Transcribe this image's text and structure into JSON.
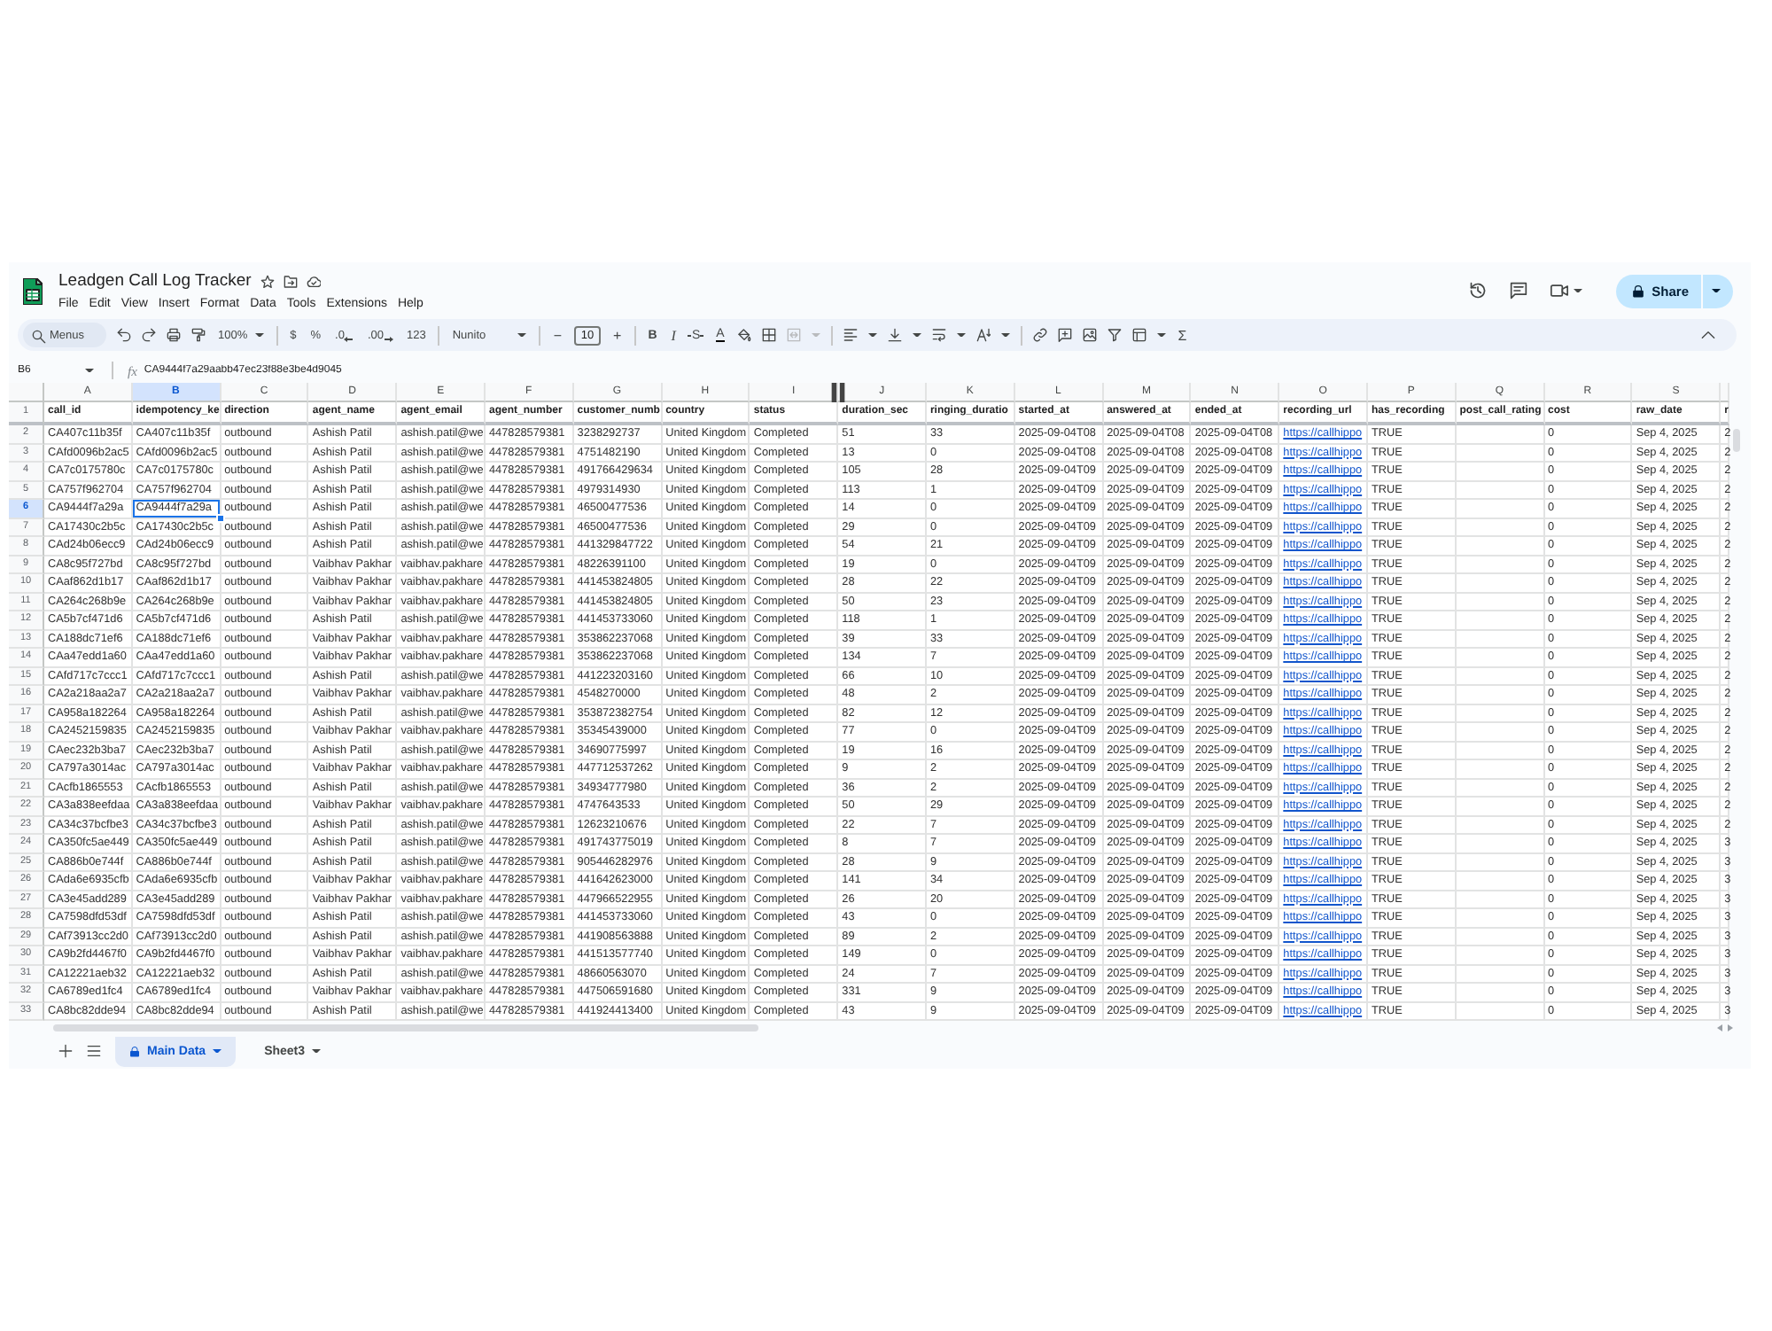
{
  "app": {
    "title": "Leadgen Call Log Tracker",
    "menu": [
      "File",
      "Edit",
      "View",
      "Insert",
      "Format",
      "Data",
      "Tools",
      "Extensions",
      "Help"
    ],
    "share_label": "Share"
  },
  "toolbar": {
    "search": {
      "placeholder": "Menus"
    },
    "zoom": "100%",
    "currency": "$",
    "percent": "%",
    "decrease_decimals": ".0",
    "increase_decimals": ".00",
    "number_format": "123",
    "font": "Nunito",
    "decrease_font": "−",
    "font_size": "10",
    "increase_font": "+",
    "bold": "B",
    "italic": "I",
    "strikethrough": "S",
    "text_color": "A",
    "merge_cells": {
      "disabled": true
    },
    "functions": "Σ"
  },
  "formula_bar": {
    "cell_ref": "B6",
    "fx": "fx",
    "value": "CA9444f7a29aabb47ec23f88e3be4d9045"
  },
  "sheet": {
    "columns": [
      {
        "letter": "A",
        "selected": false,
        "header": "call_id",
        "kind": "text"
      },
      {
        "letter": "B",
        "selected": true,
        "header": "idempotency_ke",
        "kind": "text"
      },
      {
        "letter": "C",
        "selected": false,
        "header": "direction",
        "kind": "text"
      },
      {
        "letter": "D",
        "selected": false,
        "header": "agent_name",
        "kind": "text"
      },
      {
        "letter": "E",
        "selected": false,
        "header": "agent_email",
        "kind": "text"
      },
      {
        "letter": "F",
        "selected": false,
        "header": "agent_number",
        "kind": "text"
      },
      {
        "letter": "G",
        "selected": false,
        "header": "customer_numb",
        "kind": "text"
      },
      {
        "letter": "H",
        "selected": false,
        "header": "country",
        "kind": "text"
      },
      {
        "letter": "I",
        "selected": false,
        "header": "status",
        "kind": "text"
      },
      {
        "letter": "J",
        "selected": false,
        "header": "duration_sec",
        "kind": "text"
      },
      {
        "letter": "K",
        "selected": false,
        "header": "ringing_duratio",
        "kind": "text"
      },
      {
        "letter": "L",
        "selected": false,
        "header": "started_at",
        "kind": "text"
      },
      {
        "letter": "M",
        "selected": false,
        "header": "answered_at",
        "kind": "text"
      },
      {
        "letter": "N",
        "selected": false,
        "header": "ended_at",
        "kind": "text"
      },
      {
        "letter": "O",
        "selected": false,
        "header": "recording_url",
        "kind": "link"
      },
      {
        "letter": "P",
        "selected": false,
        "header": "has_recording",
        "kind": "text"
      },
      {
        "letter": "Q",
        "selected": false,
        "header": "post_call_rating",
        "kind": "text"
      },
      {
        "letter": "R",
        "selected": false,
        "header": "cost",
        "kind": "text"
      },
      {
        "letter": "S",
        "selected": false,
        "header": "raw_date",
        "kind": "text"
      },
      {
        "selected": false,
        "header": "r",
        "kind": "text"
      }
    ],
    "header_row": {
      "number": "1",
      "selected": false
    },
    "rows": [
      {
        "number": "2",
        "selected": false,
        "cells": [
          "CA407c11b35f",
          "CA407c11b35f",
          "outbound",
          "Ashish Patil",
          "ashish.patil@we",
          "447828579381",
          "3238292737",
          "United Kingdom",
          "Completed",
          "51",
          "33",
          "2025-09-04T08",
          "2025-09-04T08",
          "2025-09-04T08",
          "https://callhippo",
          "TRUE",
          null,
          "0",
          "Sep 4, 2025",
          "2"
        ]
      },
      {
        "number": "3",
        "selected": false,
        "cells": [
          "CAfd0096b2ac5",
          "CAfd0096b2ac5",
          "outbound",
          "Ashish Patil",
          "ashish.patil@we",
          "447828579381",
          "4751482190",
          "United Kingdom",
          "Completed",
          "13",
          "0",
          "2025-09-04T08",
          "2025-09-04T08",
          "2025-09-04T08",
          "https://callhippo",
          "TRUE",
          null,
          "0",
          "Sep 4, 2025",
          "2"
        ]
      },
      {
        "number": "4",
        "selected": false,
        "cells": [
          "CA7c0175780c",
          "CA7c0175780c",
          "outbound",
          "Ashish Patil",
          "ashish.patil@we",
          "447828579381",
          "491766429634",
          "United Kingdom",
          "Completed",
          "105",
          "28",
          "2025-09-04T09",
          "2025-09-04T09",
          "2025-09-04T09",
          "https://callhippo",
          "TRUE",
          null,
          "0",
          "Sep 4, 2025",
          "2"
        ]
      },
      {
        "number": "5",
        "selected": false,
        "cells": [
          "CA757f962704",
          "CA757f962704",
          "outbound",
          "Ashish Patil",
          "ashish.patil@we",
          "447828579381",
          "4979314930",
          "United Kingdom",
          "Completed",
          "113",
          "1",
          "2025-09-04T09",
          "2025-09-04T09",
          "2025-09-04T09",
          "https://callhippo",
          "TRUE",
          null,
          "0",
          "Sep 4, 2025",
          "2"
        ]
      },
      {
        "number": "6",
        "selected": true,
        "cells": [
          "CA9444f7a29a",
          "CA9444f7a29a",
          "outbound",
          "Ashish Patil",
          "ashish.patil@we",
          "447828579381",
          "46500477536",
          "United Kingdom",
          "Completed",
          "14",
          "0",
          "2025-09-04T09",
          "2025-09-04T09",
          "2025-09-04T09",
          "https://callhippo",
          "TRUE",
          null,
          "0",
          "Sep 4, 2025",
          "2"
        ]
      },
      {
        "number": "7",
        "selected": false,
        "cells": [
          "CA17430c2b5c",
          "CA17430c2b5c",
          "outbound",
          "Ashish Patil",
          "ashish.patil@we",
          "447828579381",
          "46500477536",
          "United Kingdom",
          "Completed",
          "29",
          "0",
          "2025-09-04T09",
          "2025-09-04T09",
          "2025-09-04T09",
          "https://callhippo",
          "TRUE",
          null,
          "0",
          "Sep 4, 2025",
          "2"
        ]
      },
      {
        "number": "8",
        "selected": false,
        "cells": [
          "CAd24b06ecc9",
          "CAd24b06ecc9",
          "outbound",
          "Ashish Patil",
          "ashish.patil@we",
          "447828579381",
          "441329847722",
          "United Kingdom",
          "Completed",
          "54",
          "21",
          "2025-09-04T09",
          "2025-09-04T09",
          "2025-09-04T09",
          "https://callhippo",
          "TRUE",
          null,
          "0",
          "Sep 4, 2025",
          "2"
        ]
      },
      {
        "number": "9",
        "selected": false,
        "cells": [
          "CA8c95f727bd",
          "CA8c95f727bd",
          "outbound",
          "Vaibhav Pakhar",
          "vaibhav.pakhare",
          "447828579381",
          "48226391100",
          "United Kingdom",
          "Completed",
          "19",
          "0",
          "2025-09-04T09",
          "2025-09-04T09",
          "2025-09-04T09",
          "https://callhippo",
          "TRUE",
          null,
          "0",
          "Sep 4, 2025",
          "2"
        ]
      },
      {
        "number": "10",
        "selected": false,
        "cells": [
          "CAaf862d1b17",
          "CAaf862d1b17",
          "outbound",
          "Vaibhav Pakhar",
          "vaibhav.pakhare",
          "447828579381",
          "441453824805",
          "United Kingdom",
          "Completed",
          "28",
          "22",
          "2025-09-04T09",
          "2025-09-04T09",
          "2025-09-04T09",
          "https://callhippo",
          "TRUE",
          null,
          "0",
          "Sep 4, 2025",
          "2"
        ]
      },
      {
        "number": "11",
        "selected": false,
        "cells": [
          "CA264c268b9e",
          "CA264c268b9e",
          "outbound",
          "Vaibhav Pakhar",
          "vaibhav.pakhare",
          "447828579381",
          "441453824805",
          "United Kingdom",
          "Completed",
          "50",
          "23",
          "2025-09-04T09",
          "2025-09-04T09",
          "2025-09-04T09",
          "https://callhippo",
          "TRUE",
          null,
          "0",
          "Sep 4, 2025",
          "2"
        ]
      },
      {
        "number": "12",
        "selected": false,
        "cells": [
          "CA5b7cf471d6",
          "CA5b7cf471d6",
          "outbound",
          "Ashish Patil",
          "ashish.patil@we",
          "447828579381",
          "441453733060",
          "United Kingdom",
          "Completed",
          "118",
          "1",
          "2025-09-04T09",
          "2025-09-04T09",
          "2025-09-04T09",
          "https://callhippo",
          "TRUE",
          null,
          "0",
          "Sep 4, 2025",
          "2"
        ]
      },
      {
        "number": "13",
        "selected": false,
        "cells": [
          "CA188dc71ef6",
          "CA188dc71ef6",
          "outbound",
          "Vaibhav Pakhar",
          "vaibhav.pakhare",
          "447828579381",
          "353862237068",
          "United Kingdom",
          "Completed",
          "39",
          "33",
          "2025-09-04T09",
          "2025-09-04T09",
          "2025-09-04T09",
          "https://callhippo",
          "TRUE",
          null,
          "0",
          "Sep 4, 2025",
          "2"
        ]
      },
      {
        "number": "14",
        "selected": false,
        "cells": [
          "CAa47edd1a60",
          "CAa47edd1a60",
          "outbound",
          "Vaibhav Pakhar",
          "vaibhav.pakhare",
          "447828579381",
          "353862237068",
          "United Kingdom",
          "Completed",
          "134",
          "7",
          "2025-09-04T09",
          "2025-09-04T09",
          "2025-09-04T09",
          "https://callhippo",
          "TRUE",
          null,
          "0",
          "Sep 4, 2025",
          "2"
        ]
      },
      {
        "number": "15",
        "selected": false,
        "cells": [
          "CAfd717c7ccc1",
          "CAfd717c7ccc1",
          "outbound",
          "Ashish Patil",
          "ashish.patil@we",
          "447828579381",
          "441223203160",
          "United Kingdom",
          "Completed",
          "66",
          "10",
          "2025-09-04T09",
          "2025-09-04T09",
          "2025-09-04T09",
          "https://callhippo",
          "TRUE",
          null,
          "0",
          "Sep 4, 2025",
          "2"
        ]
      },
      {
        "number": "16",
        "selected": false,
        "cells": [
          "CA2a218aa2a7",
          "CA2a218aa2a7",
          "outbound",
          "Vaibhav Pakhar",
          "vaibhav.pakhare",
          "447828579381",
          "4548270000",
          "United Kingdom",
          "Completed",
          "48",
          "2",
          "2025-09-04T09",
          "2025-09-04T09",
          "2025-09-04T09",
          "https://callhippo",
          "TRUE",
          null,
          "0",
          "Sep 4, 2025",
          "2"
        ]
      },
      {
        "number": "17",
        "selected": false,
        "cells": [
          "CA958a182264",
          "CA958a182264",
          "outbound",
          "Ashish Patil",
          "ashish.patil@we",
          "447828579381",
          "353872382754",
          "United Kingdom",
          "Completed",
          "82",
          "12",
          "2025-09-04T09",
          "2025-09-04T09",
          "2025-09-04T09",
          "https://callhippo",
          "TRUE",
          null,
          "0",
          "Sep 4, 2025",
          "2"
        ]
      },
      {
        "number": "18",
        "selected": false,
        "cells": [
          "CA2452159835",
          "CA2452159835",
          "outbound",
          "Vaibhav Pakhar",
          "vaibhav.pakhare",
          "447828579381",
          "35345439000",
          "United Kingdom",
          "Completed",
          "77",
          "0",
          "2025-09-04T09",
          "2025-09-04T09",
          "2025-09-04T09",
          "https://callhippo",
          "TRUE",
          null,
          "0",
          "Sep 4, 2025",
          "2"
        ]
      },
      {
        "number": "19",
        "selected": false,
        "cells": [
          "CAec232b3ba7",
          "CAec232b3ba7",
          "outbound",
          "Ashish Patil",
          "ashish.patil@we",
          "447828579381",
          "34690775997",
          "United Kingdom",
          "Completed",
          "19",
          "16",
          "2025-09-04T09",
          "2025-09-04T09",
          "2025-09-04T09",
          "https://callhippo",
          "TRUE",
          null,
          "0",
          "Sep 4, 2025",
          "2"
        ]
      },
      {
        "number": "20",
        "selected": false,
        "cells": [
          "CA797a3014ac",
          "CA797a3014ac",
          "outbound",
          "Vaibhav Pakhar",
          "vaibhav.pakhare",
          "447828579381",
          "447712537262",
          "United Kingdom",
          "Completed",
          "9",
          "2",
          "2025-09-04T09",
          "2025-09-04T09",
          "2025-09-04T09",
          "https://callhippo",
          "TRUE",
          null,
          "0",
          "Sep 4, 2025",
          "2"
        ]
      },
      {
        "number": "21",
        "selected": false,
        "cells": [
          "CAcfb1865553",
          "CAcfb1865553",
          "outbound",
          "Ashish Patil",
          "ashish.patil@we",
          "447828579381",
          "34934777980",
          "United Kingdom",
          "Completed",
          "36",
          "2",
          "2025-09-04T09",
          "2025-09-04T09",
          "2025-09-04T09",
          "https://callhippo",
          "TRUE",
          null,
          "0",
          "Sep 4, 2025",
          "2"
        ]
      },
      {
        "number": "22",
        "selected": false,
        "cells": [
          "CA3a838eefdaa",
          "CA3a838eefdaa",
          "outbound",
          "Vaibhav Pakhar",
          "vaibhav.pakhare",
          "447828579381",
          "4747643533",
          "United Kingdom",
          "Completed",
          "50",
          "29",
          "2025-09-04T09",
          "2025-09-04T09",
          "2025-09-04T09",
          "https://callhippo",
          "TRUE",
          null,
          "0",
          "Sep 4, 2025",
          "2"
        ]
      },
      {
        "number": "23",
        "selected": false,
        "cells": [
          "CA34c37bcfbe3",
          "CA34c37bcfbe3",
          "outbound",
          "Ashish Patil",
          "ashish.patil@we",
          "447828579381",
          "12623210676",
          "United Kingdom",
          "Completed",
          "22",
          "7",
          "2025-09-04T09",
          "2025-09-04T09",
          "2025-09-04T09",
          "https://callhippo",
          "TRUE",
          null,
          "0",
          "Sep 4, 2025",
          "2"
        ]
      },
      {
        "number": "24",
        "selected": false,
        "cells": [
          "CA350fc5ae449",
          "CA350fc5ae449",
          "outbound",
          "Ashish Patil",
          "ashish.patil@we",
          "447828579381",
          "491743775019",
          "United Kingdom",
          "Completed",
          "8",
          "7",
          "2025-09-04T09",
          "2025-09-04T09",
          "2025-09-04T09",
          "https://callhippo",
          "TRUE",
          null,
          "0",
          "Sep 4, 2025",
          "3"
        ]
      },
      {
        "number": "25",
        "selected": false,
        "cells": [
          "CA886b0e744f",
          "CA886b0e744f",
          "outbound",
          "Ashish Patil",
          "ashish.patil@we",
          "447828579381",
          "905446282976",
          "United Kingdom",
          "Completed",
          "28",
          "9",
          "2025-09-04T09",
          "2025-09-04T09",
          "2025-09-04T09",
          "https://callhippo",
          "TRUE",
          null,
          "0",
          "Sep 4, 2025",
          "3"
        ]
      },
      {
        "number": "26",
        "selected": false,
        "cells": [
          "CAda6e6935cfb",
          "CAda6e6935cfb",
          "outbound",
          "Vaibhav Pakhar",
          "vaibhav.pakhare",
          "447828579381",
          "441642623000",
          "United Kingdom",
          "Completed",
          "141",
          "34",
          "2025-09-04T09",
          "2025-09-04T09",
          "2025-09-04T09",
          "https://callhippo",
          "TRUE",
          null,
          "0",
          "Sep 4, 2025",
          "3"
        ]
      },
      {
        "number": "27",
        "selected": false,
        "cells": [
          "CA3e45add289",
          "CA3e45add289",
          "outbound",
          "Vaibhav Pakhar",
          "vaibhav.pakhare",
          "447828579381",
          "447966522955",
          "United Kingdom",
          "Completed",
          "26",
          "20",
          "2025-09-04T09",
          "2025-09-04T09",
          "2025-09-04T09",
          "https://callhippo",
          "TRUE",
          null,
          "0",
          "Sep 4, 2025",
          "3"
        ]
      },
      {
        "number": "28",
        "selected": false,
        "cells": [
          "CA7598dfd53df",
          "CA7598dfd53df",
          "outbound",
          "Ashish Patil",
          "ashish.patil@we",
          "447828579381",
          "441453733060",
          "United Kingdom",
          "Completed",
          "43",
          "0",
          "2025-09-04T09",
          "2025-09-04T09",
          "2025-09-04T09",
          "https://callhippo",
          "TRUE",
          null,
          "0",
          "Sep 4, 2025",
          "3"
        ]
      },
      {
        "number": "29",
        "selected": false,
        "cells": [
          "CAf73913cc2d0",
          "CAf73913cc2d0",
          "outbound",
          "Ashish Patil",
          "ashish.patil@we",
          "447828579381",
          "441908563888",
          "United Kingdom",
          "Completed",
          "89",
          "2",
          "2025-09-04T09",
          "2025-09-04T09",
          "2025-09-04T09",
          "https://callhippo",
          "TRUE",
          null,
          "0",
          "Sep 4, 2025",
          "3"
        ]
      },
      {
        "number": "30",
        "selected": false,
        "cells": [
          "CA9b2fd4467f0",
          "CA9b2fd4467f0",
          "outbound",
          "Vaibhav Pakhar",
          "vaibhav.pakhare",
          "447828579381",
          "441513577740",
          "United Kingdom",
          "Completed",
          "149",
          "0",
          "2025-09-04T09",
          "2025-09-04T09",
          "2025-09-04T09",
          "https://callhippo",
          "TRUE",
          null,
          "0",
          "Sep 4, 2025",
          "3"
        ]
      },
      {
        "number": "31",
        "selected": false,
        "cells": [
          "CA12221aeb32",
          "CA12221aeb32",
          "outbound",
          "Ashish Patil",
          "ashish.patil@we",
          "447828579381",
          "48660563070",
          "United Kingdom",
          "Completed",
          "24",
          "7",
          "2025-09-04T09",
          "2025-09-04T09",
          "2025-09-04T09",
          "https://callhippo",
          "TRUE",
          null,
          "0",
          "Sep 4, 2025",
          "3"
        ]
      },
      {
        "number": "32",
        "selected": false,
        "cells": [
          "CA6789ed1fc4",
          "CA6789ed1fc4",
          "outbound",
          "Vaibhav Pakhar",
          "vaibhav.pakhare",
          "447828579381",
          "447506591680",
          "United Kingdom",
          "Completed",
          "331",
          "9",
          "2025-09-04T09",
          "2025-09-04T09",
          "2025-09-04T09",
          "https://callhippo",
          "TRUE",
          null,
          "0",
          "Sep 4, 2025",
          "3"
        ]
      },
      {
        "number": "33",
        "selected": false,
        "cells": [
          "CA8bc82dde94",
          "CA8bc82dde94",
          "outbound",
          "Ashish Patil",
          "ashish.patil@we",
          "447828579381",
          "441924413400",
          "United Kingdom",
          "Completed",
          "43",
          "9",
          "2025-09-04T09",
          "2025-09-04T09",
          "2025-09-04T09",
          "https://callhippo",
          "TRUE",
          null,
          "0",
          "Sep 4, 2025",
          "3"
        ]
      }
    ]
  },
  "sheet_tabs": [
    {
      "label": "Main Data",
      "selected": true,
      "locked": true
    },
    {
      "label": "Sheet3",
      "selected": false,
      "locked": false
    }
  ]
}
